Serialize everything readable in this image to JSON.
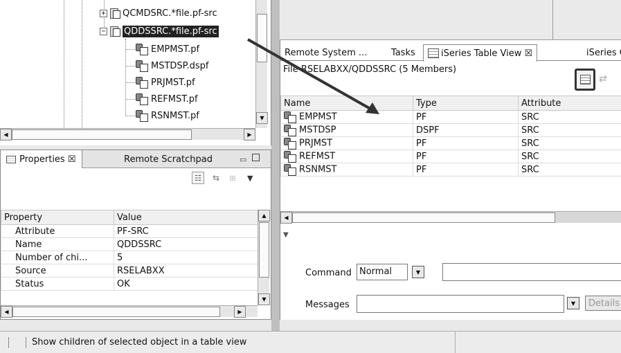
{
  "tree": {
    "nodes": [
      {
        "label": "QCMDSRC.*file.pf-src",
        "expander": "+"
      },
      {
        "label": "QDDSSRC.*file.pf-src",
        "expander": "−"
      }
    ],
    "members": [
      "EMPMST.pf",
      "MSTDSP.dspf",
      "PRJMST.pf",
      "REFMST.pf",
      "RSNMST.pf"
    ]
  },
  "properties_view": {
    "tabs": [
      "Properties ☒",
      "Remote Scratchpad"
    ],
    "headers": [
      "Property",
      "Value"
    ],
    "rows": [
      [
        "Attribute",
        "PF-SRC"
      ],
      [
        "Name",
        "QDDSSRC"
      ],
      [
        "Number of chi...",
        "5"
      ],
      [
        "Source",
        "RSELABXX"
      ],
      [
        "Status",
        "OK"
      ]
    ]
  },
  "table_view": {
    "tabs": [
      "Remote System ...",
      "Tasks",
      "iSeries Table View ☒",
      "iSeries C"
    ],
    "file_info": "File RSELABXX/QDDSSRC (5 Members)",
    "headers": [
      "Name",
      "Type",
      "Attribute"
    ],
    "rows": [
      [
        "EMPMST",
        "PF",
        "SRC"
      ],
      [
        "MSTDSP",
        "DSPF",
        "SRC"
      ],
      [
        "PRJMST",
        "PF",
        "SRC"
      ],
      [
        "REFMST",
        "PF",
        "SRC"
      ],
      [
        "RSNMST",
        "PF",
        "SRC"
      ]
    ],
    "command_label": "Command",
    "command_mode": "Normal",
    "messages_label": "Messages",
    "details_button": "Details"
  },
  "status_bar": {
    "message": "Show children of selected object in a table view"
  }
}
